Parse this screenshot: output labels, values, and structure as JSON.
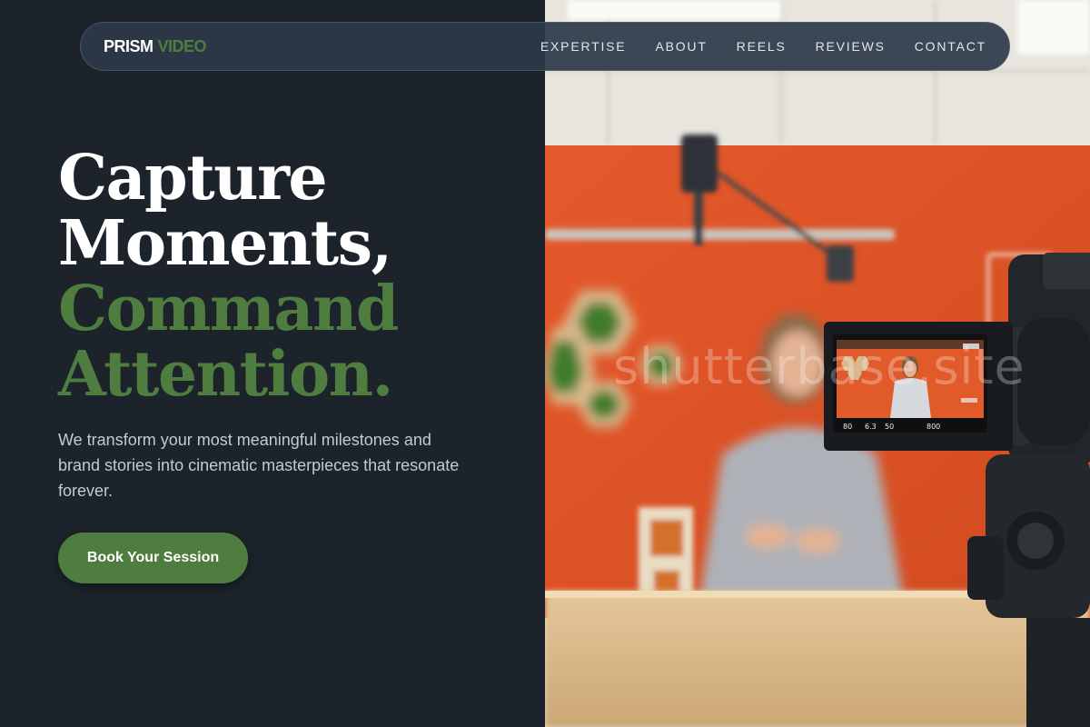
{
  "brand": {
    "word1": "PRISM",
    "word2": "VIDEO",
    "accent_color": "#4f7d3f"
  },
  "nav": {
    "items": [
      {
        "label": "EXPERTISE"
      },
      {
        "label": "ABOUT"
      },
      {
        "label": "REELS"
      },
      {
        "label": "REVIEWS"
      },
      {
        "label": "CONTACT"
      }
    ]
  },
  "hero": {
    "title_lines": [
      "Capture",
      "Moments,",
      "Command",
      "Attention."
    ],
    "subtitle": "We transform your most meaningful milestones and brand stories into cinematic masterpieces that resonate forever.",
    "cta_label": "Book Your Session"
  },
  "photo": {
    "watermark": "shutterbase.site",
    "camera_screen": {
      "readouts": [
        "6.3",
        "50",
        "800"
      ]
    }
  },
  "colors": {
    "background": "#1c232b",
    "nav_bg": "#2c3a4a",
    "orange_wall": "#e0562a"
  }
}
